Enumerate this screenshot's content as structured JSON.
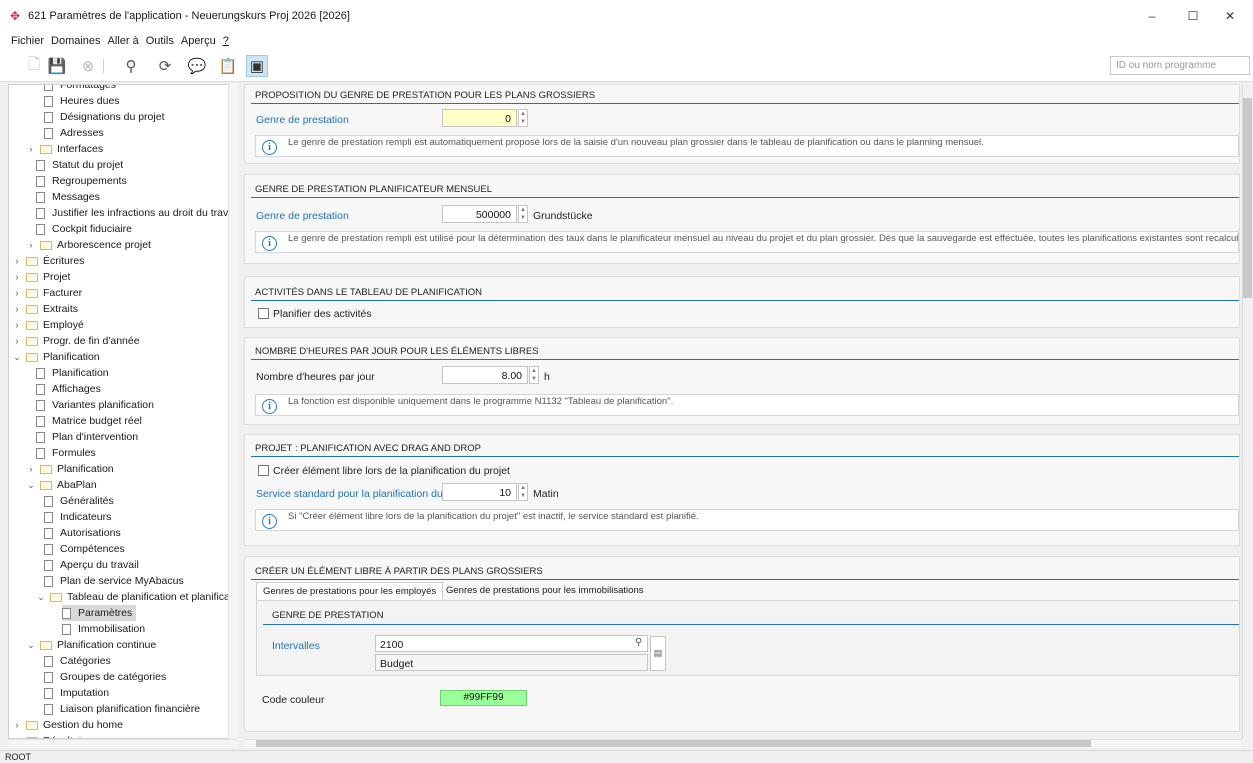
{
  "window": {
    "title": "621 Paramètres de l'application - Neuerungskurs Proj 2026 [2026]",
    "minimize": "–",
    "maximize": "☐",
    "close": "✕"
  },
  "menu": [
    "Fichier",
    "Domaines",
    "Aller à",
    "Outils",
    "Aperçu",
    "?"
  ],
  "toolbar": {
    "search_placeholder": "ID ou nom programme",
    "icons": [
      "new-file-icon",
      "save-icon",
      "cancel-icon",
      "search-icon",
      "refresh-icon",
      "add-comment-icon",
      "clipboard-settings-icon",
      "window-icon"
    ]
  },
  "tree": {
    "items": [
      {
        "label": "Formatages",
        "level": 3,
        "type": "doc"
      },
      {
        "label": "Heures dues",
        "level": 3,
        "type": "doc"
      },
      {
        "label": "Désignations du projet",
        "level": 3,
        "type": "doc"
      },
      {
        "label": "Adresses",
        "level": 3,
        "type": "doc"
      },
      {
        "label": "Interfaces",
        "level": 1,
        "type": "folder",
        "expanded": false
      },
      {
        "label": "Statut du projet",
        "level": 2,
        "type": "doc"
      },
      {
        "label": "Regroupements",
        "level": 2,
        "type": "doc"
      },
      {
        "label": "Messages",
        "level": 2,
        "type": "doc"
      },
      {
        "label": "Justifier les infractions au droit du travail",
        "level": 2,
        "type": "doc"
      },
      {
        "label": "Cockpit fiduciaire",
        "level": 2,
        "type": "doc"
      },
      {
        "label": "Arborescence projet",
        "level": 1,
        "type": "folder",
        "expanded": false
      },
      {
        "label": "Écritures",
        "level": 0,
        "type": "folder",
        "expanded": false
      },
      {
        "label": "Projet",
        "level": 0,
        "type": "folder",
        "expanded": false
      },
      {
        "label": "Facturer",
        "level": 0,
        "type": "folder",
        "expanded": false
      },
      {
        "label": "Extraits",
        "level": 0,
        "type": "folder",
        "expanded": false
      },
      {
        "label": "Employé",
        "level": 0,
        "type": "folder",
        "expanded": false
      },
      {
        "label": "Progr. de fin d'année",
        "level": 0,
        "type": "folder",
        "expanded": false
      },
      {
        "label": "Planification",
        "level": 0,
        "type": "folder",
        "expanded": true
      },
      {
        "label": "Planification",
        "level": 2,
        "type": "doc"
      },
      {
        "label": "Affichages",
        "level": 2,
        "type": "doc"
      },
      {
        "label": "Variantes planification",
        "level": 2,
        "type": "doc"
      },
      {
        "label": "Matrice budget réel",
        "level": 2,
        "type": "doc"
      },
      {
        "label": "Plan d'intervention",
        "level": 2,
        "type": "doc"
      },
      {
        "label": "Formules",
        "level": 2,
        "type": "doc"
      },
      {
        "label": "Planification",
        "level": 1,
        "type": "folder",
        "expanded": false
      },
      {
        "label": "AbaPlan",
        "level": 1,
        "type": "folder",
        "expanded": true
      },
      {
        "label": "Généralités",
        "level": 3,
        "type": "doc"
      },
      {
        "label": "Indicateurs",
        "level": 3,
        "type": "doc"
      },
      {
        "label": "Autorisations",
        "level": 3,
        "type": "doc"
      },
      {
        "label": "Compétences",
        "level": 3,
        "type": "doc"
      },
      {
        "label": "Aperçu du travail",
        "level": 3,
        "type": "doc"
      },
      {
        "label": "Plan de service MyAbacus",
        "level": 3,
        "type": "doc"
      },
      {
        "label": "Tableau de planification et planificateu",
        "level": 2,
        "type": "folder",
        "expanded": true
      },
      {
        "label": "Paramètres",
        "level": 4,
        "type": "doc",
        "selected": true
      },
      {
        "label": "Immobilisation",
        "level": 4,
        "type": "doc"
      },
      {
        "label": "Planification continue",
        "level": 1,
        "type": "folder",
        "expanded": true
      },
      {
        "label": "Catégories",
        "level": 3,
        "type": "doc"
      },
      {
        "label": "Groupes de catégories",
        "level": 3,
        "type": "doc"
      },
      {
        "label": "Imputation",
        "level": 3,
        "type": "doc"
      },
      {
        "label": "Liaison planification financière",
        "level": 3,
        "type": "doc"
      },
      {
        "label": "Gestion du home",
        "level": 0,
        "type": "folder",
        "expanded": false
      },
      {
        "label": "Résultats",
        "level": 0,
        "type": "folder",
        "expanded": false
      }
    ]
  },
  "panels": {
    "p1": {
      "title": "PROPOSITION DU GENRE DE PRESTATION POUR LES PLANS GROSSIERS",
      "field_label": "Genre de prestation",
      "field_value": "0",
      "info": "Le genre de prestation rempli est automatiquement proposé lors de la saisie d'un nouveau plan grossier dans le tableau de planification ou dans le planning mensuel."
    },
    "p2": {
      "title": "GENRE DE PRESTATION PLANIFICATEUR MENSUEL",
      "field_label": "Genre de prestation",
      "field_value": "500000",
      "field_suffix": "Grundstücke",
      "info": "Le genre de prestation rempli est utilisé pour la détermination des taux dans le planificateur mensuel au niveau du projet et du plan grossier. Dès que la sauvegarde est effectuée, toutes les planifications existantes sont recalculées"
    },
    "p3": {
      "title": "ACTIVITÉS DANS LE TABLEAU DE PLANIFICATION",
      "checkbox_label": "Planifier des activités",
      "checked": false
    },
    "p4": {
      "title": "NOMBRE D'HEURES PAR JOUR POUR LES ÉLÉMENTS LIBRES",
      "field_label": "Nombre d'heures par jour",
      "field_value": "8.00",
      "field_suffix": "h",
      "info": "La fonction est disponible uniquement dans le programme N1132 \"Tableau de planification\"."
    },
    "p5": {
      "title": "PROJET : PLANIFICATION AVEC DRAG AND DROP",
      "checkbox_label": "Créer élément libre lors de la planification du projet",
      "checked": false,
      "field_label": "Service standard pour la planification du pr...",
      "field_value": "10",
      "field_suffix": "Matin",
      "info": "Si \"Créer élément libre lors de la planification du projet\" est inactif, le service standard est planifié."
    },
    "p6": {
      "title": "CRÉER UN ÉLÉMENT LIBRE À PARTIR DES PLANS GROSSIERS",
      "tabs": [
        "Genres de prestations pour les employés",
        "Genres de prestations pour les immobilisations"
      ],
      "sub_title": "GENRE DE PRESTATION",
      "intervals_label": "Intervalles",
      "intervals_value": "2100",
      "intervals_desc": "Budget",
      "color_label": "Code couleur",
      "color_value": "#99FF99"
    }
  },
  "status": "ROOT"
}
